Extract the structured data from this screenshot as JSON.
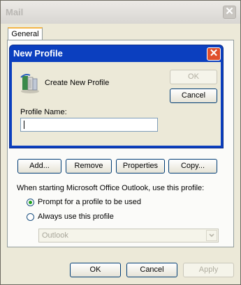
{
  "window": {
    "title": "Mail",
    "close_symbol": "✕"
  },
  "tabs": [
    {
      "label": "General",
      "selected": true
    }
  ],
  "dialog": {
    "title": "New Profile",
    "close_symbol": "✕",
    "heading": "Create New Profile",
    "ok_label": "OK",
    "cancel_label": "Cancel",
    "profile_name_label": "Profile Name:",
    "profile_name_value": ""
  },
  "profile_buttons": {
    "add": "Add...",
    "remove": "Remove",
    "properties": "Properties",
    "copy": "Copy..."
  },
  "startup": {
    "label": "When starting Microsoft Office Outlook, use this profile:",
    "options": [
      {
        "label": "Prompt for a profile to be used",
        "checked": true
      },
      {
        "label": "Always use this profile",
        "checked": false
      }
    ],
    "profile_select": {
      "value": "Outlook",
      "enabled": false
    }
  },
  "footer": {
    "ok": "OK",
    "cancel": "Cancel",
    "apply": "Apply"
  },
  "icons": {
    "profile": "profile-wizard-icon"
  }
}
